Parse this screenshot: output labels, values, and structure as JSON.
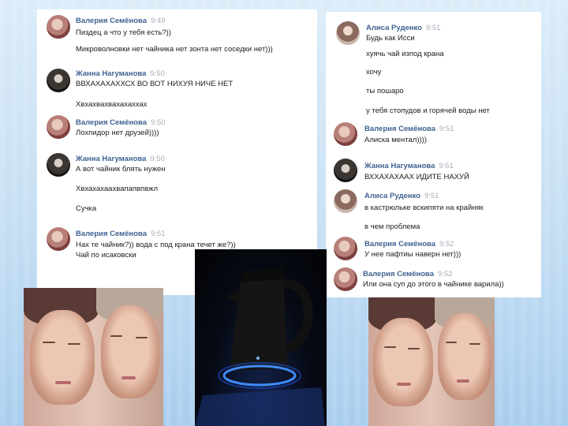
{
  "chat_left": [
    {
      "name": "Валерия Семёнова",
      "time": "9:49",
      "lines": [
        "Пиздец а что у тебя есть?))",
        "Микроволновки нет чайника нет зонта нет соседки нет)))"
      ]
    },
    {
      "name": "Жанна Нагуманова",
      "time": "9:50",
      "lines": [
        "ВВХАХАХАХХСХ ВО ВОТ НИХУЯ НИЧЕ НЕТ",
        "Хвхахвахвахахаххах"
      ]
    },
    {
      "name": "Валерия Семёнова",
      "time": "9:50",
      "lines": [
        "Лохпидор нет друзей))))"
      ]
    },
    {
      "name": "Жанна Нагуманова",
      "time": "9:50",
      "lines": [
        "А вот чайник блять нужен",
        "Хвхахахаахвапапвпвжл",
        "Сучка"
      ]
    },
    {
      "name": "Валерия Семёнова",
      "time": "9:51",
      "lines": [
        "Нах те чайник?)) вода с под крана течет же?))",
        "Чай по исаковски"
      ]
    }
  ],
  "chat_right": [
    {
      "name": "Алиса Руденко",
      "time": "9:51",
      "lines": [
        "Будь как Исси",
        "хуячь чай изпод крана",
        "хочу",
        "ты пошаро",
        "у тебя стопудов и горячей воды нет"
      ]
    },
    {
      "name": "Валерия Семёнова",
      "time": "9:51",
      "lines": [
        "Алиска ментал))))"
      ]
    },
    {
      "name": "Жанна Нагуманова",
      "time": "9:51",
      "lines": [
        "ВХХАХАХААХ ИДИТЕ НАХУЙ"
      ]
    },
    {
      "name": "Алиса Руденко",
      "time": "9:51",
      "lines": [
        "в кастрюльке вскипяти на крайняк",
        "в чем проблема"
      ]
    },
    {
      "name": "Валерия Семёнова",
      "time": "9:52",
      "lines": [
        "У нее пафтиы наверн нет)))"
      ]
    },
    {
      "name": "Валерия Семёнова",
      "time": "9:52",
      "lines": [
        "Или она суп до этого в чайнике варила))"
      ]
    }
  ],
  "icons": {
    "avatar": "user-avatar-icon",
    "kettle": "electric-kettle-photo"
  }
}
